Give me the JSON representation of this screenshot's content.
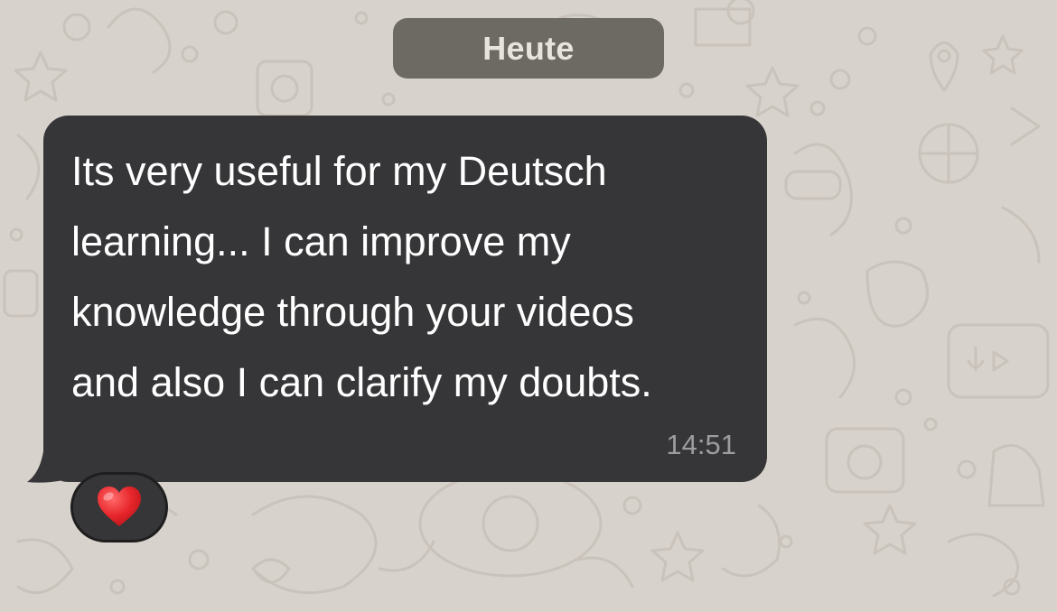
{
  "chat": {
    "date_divider": "Heute",
    "message": {
      "text": "Its very useful for my Deutsch\nlearning... I can improve my\nknowledge through your videos\nand also I can clarify my doubts.",
      "time": "14:51",
      "reaction": "heart-icon"
    }
  },
  "colors": {
    "wallpaper": "#d7d2cb",
    "bubble": "#363638",
    "date_pill": "#6d6963",
    "heart": "#e8262b"
  }
}
